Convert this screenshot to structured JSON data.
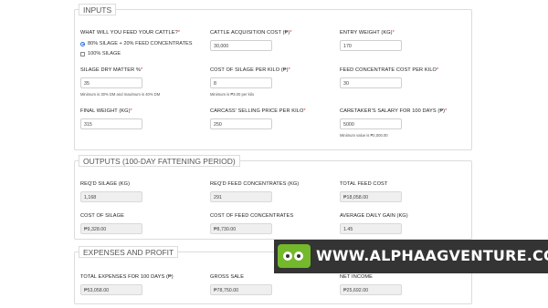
{
  "inputs": {
    "title": "INPUTS",
    "feed_question": "WHAT WILL YOU FEED YOUR CATTLE?",
    "option1": "80% SILAGE + 20% FEED CONCENTRATES",
    "option2": "100% SILAGE",
    "selected_option": "80% SILAGE + 20% FEED CONCENTRATES",
    "cattle_cost_label": "CATTLE ACQUISITION COST (₱)",
    "cattle_cost_value": "30,000",
    "entry_weight_label": "ENTRY WEIGHT (KG)",
    "entry_weight_value": "170",
    "silage_dm_label": "SILAGE DRY MATTER %",
    "silage_dm_value": "35",
    "silage_dm_help": "Minimum is 30% DM and maximum is 40% DM",
    "silage_cost_label": "COST OF SILAGE PER KILO (₱)",
    "silage_cost_value": "8",
    "silage_cost_help": "Minimum is ₱3.00 per kilo",
    "conc_cost_label": "FEED CONCENTRATE COST PER KILO",
    "conc_cost_value": "30",
    "final_weight_label": "FINAL WEIGHT (KG)",
    "final_weight_value": "315",
    "selling_price_label": "CARCASS' SELLING PRICE PER KILO",
    "selling_price_value": "250",
    "caretaker_label": "CARETAKER'S SALARY FOR 100 DAYS (₱)",
    "caretaker_value": "5000",
    "caretaker_help": "Minimum value is ₱2,000.00"
  },
  "outputs": {
    "title": "OUTPUTS (100-DAY FATTENING PERIOD)",
    "req_silage_label": "REQ'D SILAGE (KG)",
    "req_silage_value": "1,168",
    "req_conc_label": "REQ'D FEED CONCENTRATES (KG)",
    "req_conc_value": "291",
    "total_feed_label": "TOTAL FEED COST",
    "total_feed_value": "₱18,058.00",
    "cost_silage_label": "COST OF SILAGE",
    "cost_silage_value": "₱9,328.00",
    "cost_conc_label": "COST OF FEED CONCENTRATES",
    "cost_conc_value": "₱8,730.00",
    "adg_label": "AVERAGE DAILY GAIN (KG)",
    "adg_value": "1.45"
  },
  "expenses": {
    "title": "EXPENSES AND PROFIT",
    "total_exp_label": "TOTAL EXPENSES FOR 100 DAYS (₱)",
    "total_exp_value": "₱53,058.00",
    "gross_sale_label": "GROSS SALE",
    "gross_sale_value": "₱78,750.00",
    "net_income_label": "NET INCOME",
    "net_income_value": "₱25,692.00"
  },
  "banner": {
    "text": "WWW.ALPHAAGVENTURE.COM"
  },
  "colors": {
    "required_asterisk": "#e23030",
    "banner_bg": "#343434",
    "logo_green": "#74b82c"
  }
}
